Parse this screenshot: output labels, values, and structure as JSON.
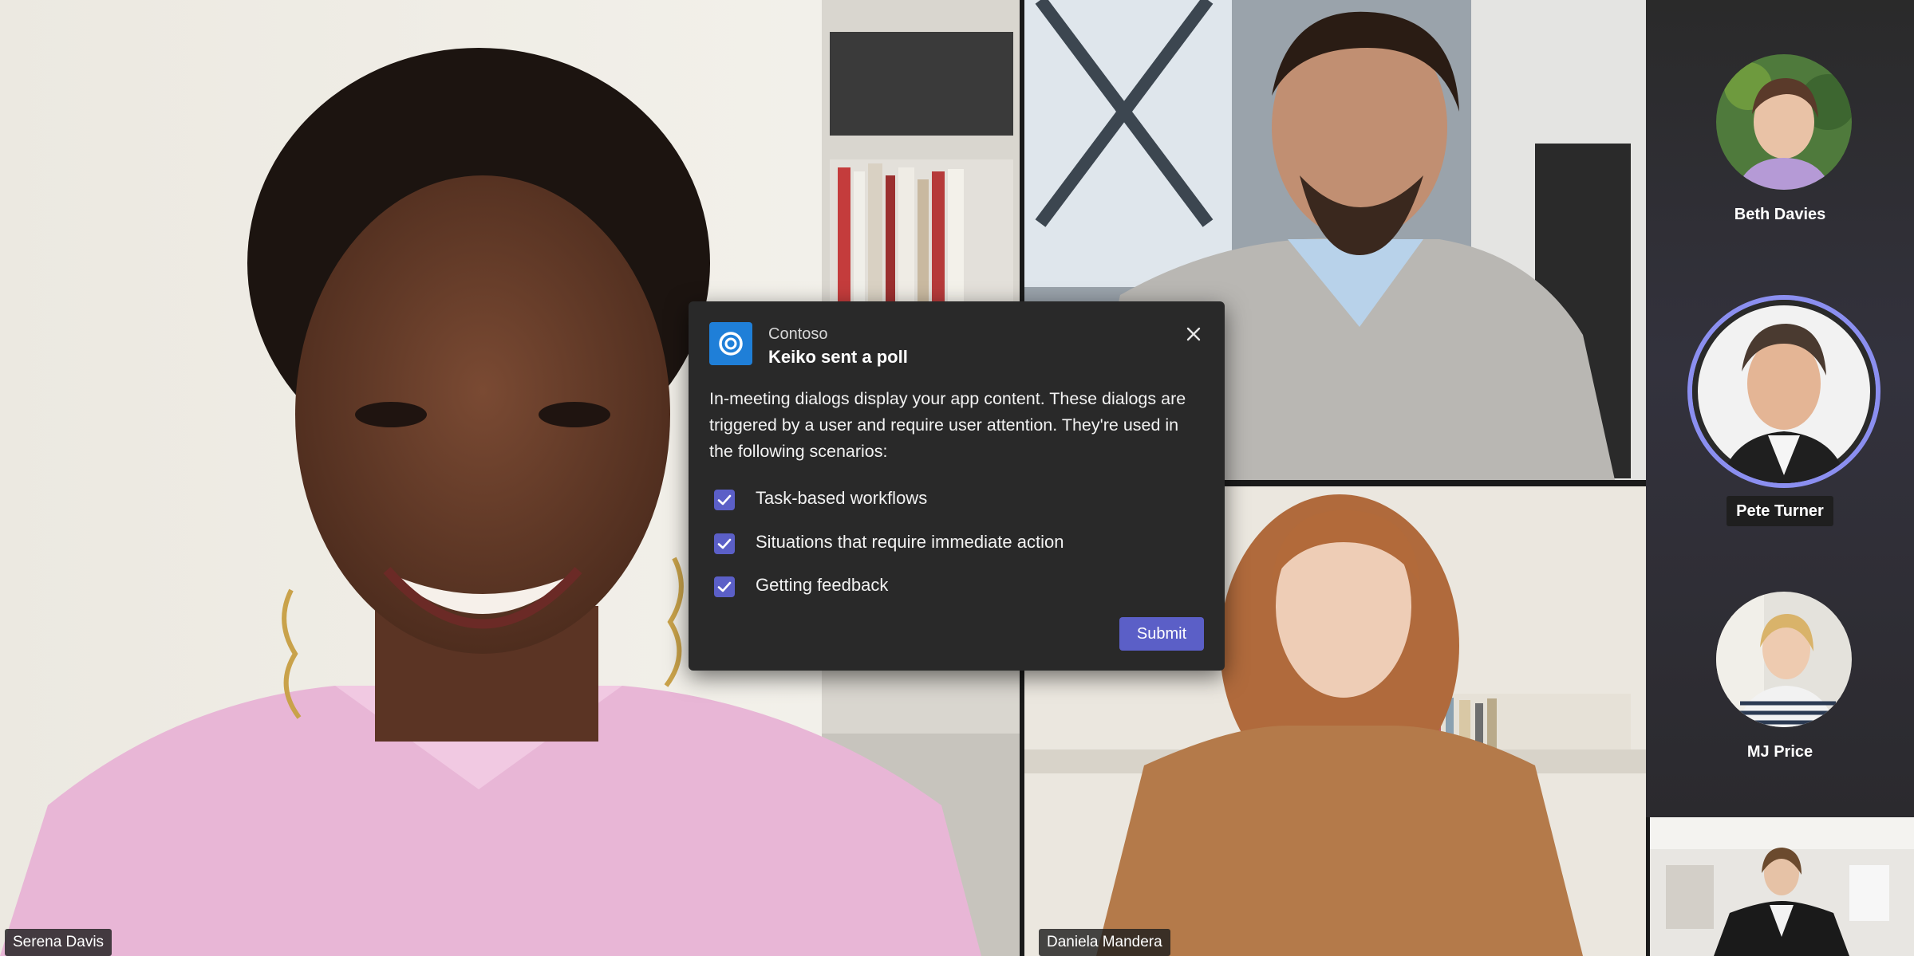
{
  "participants": {
    "main": {
      "name": "Serena Davis"
    },
    "top_right": {
      "name": ""
    },
    "bottom_right": {
      "name": "Daniela Mandera"
    }
  },
  "rail": {
    "people": [
      {
        "name": "Beth Davies",
        "speaking": false
      },
      {
        "name": "Pete Turner",
        "speaking": true
      },
      {
        "name": "MJ Price",
        "speaking": false
      }
    ]
  },
  "dialog": {
    "app_name": "Contoso",
    "title": "Keiko sent a poll",
    "body": "In-meeting dialogs display your app content. These dialogs are triggered by a user and require user attention. They're used in the following scenarios:",
    "options": [
      {
        "label": "Task-based workflows",
        "checked": true
      },
      {
        "label": "Situations that require immediate action",
        "checked": true
      },
      {
        "label": "Getting feedback",
        "checked": true
      }
    ],
    "submit_label": "Submit",
    "close_icon": "close-icon",
    "app_icon": "contoso-logo-icon"
  },
  "colors": {
    "accent": "#5b5fc7",
    "dialog_bg": "#292929",
    "app_icon_bg": "#1f7fd8",
    "speaking_ring": "#8b8ff0"
  }
}
